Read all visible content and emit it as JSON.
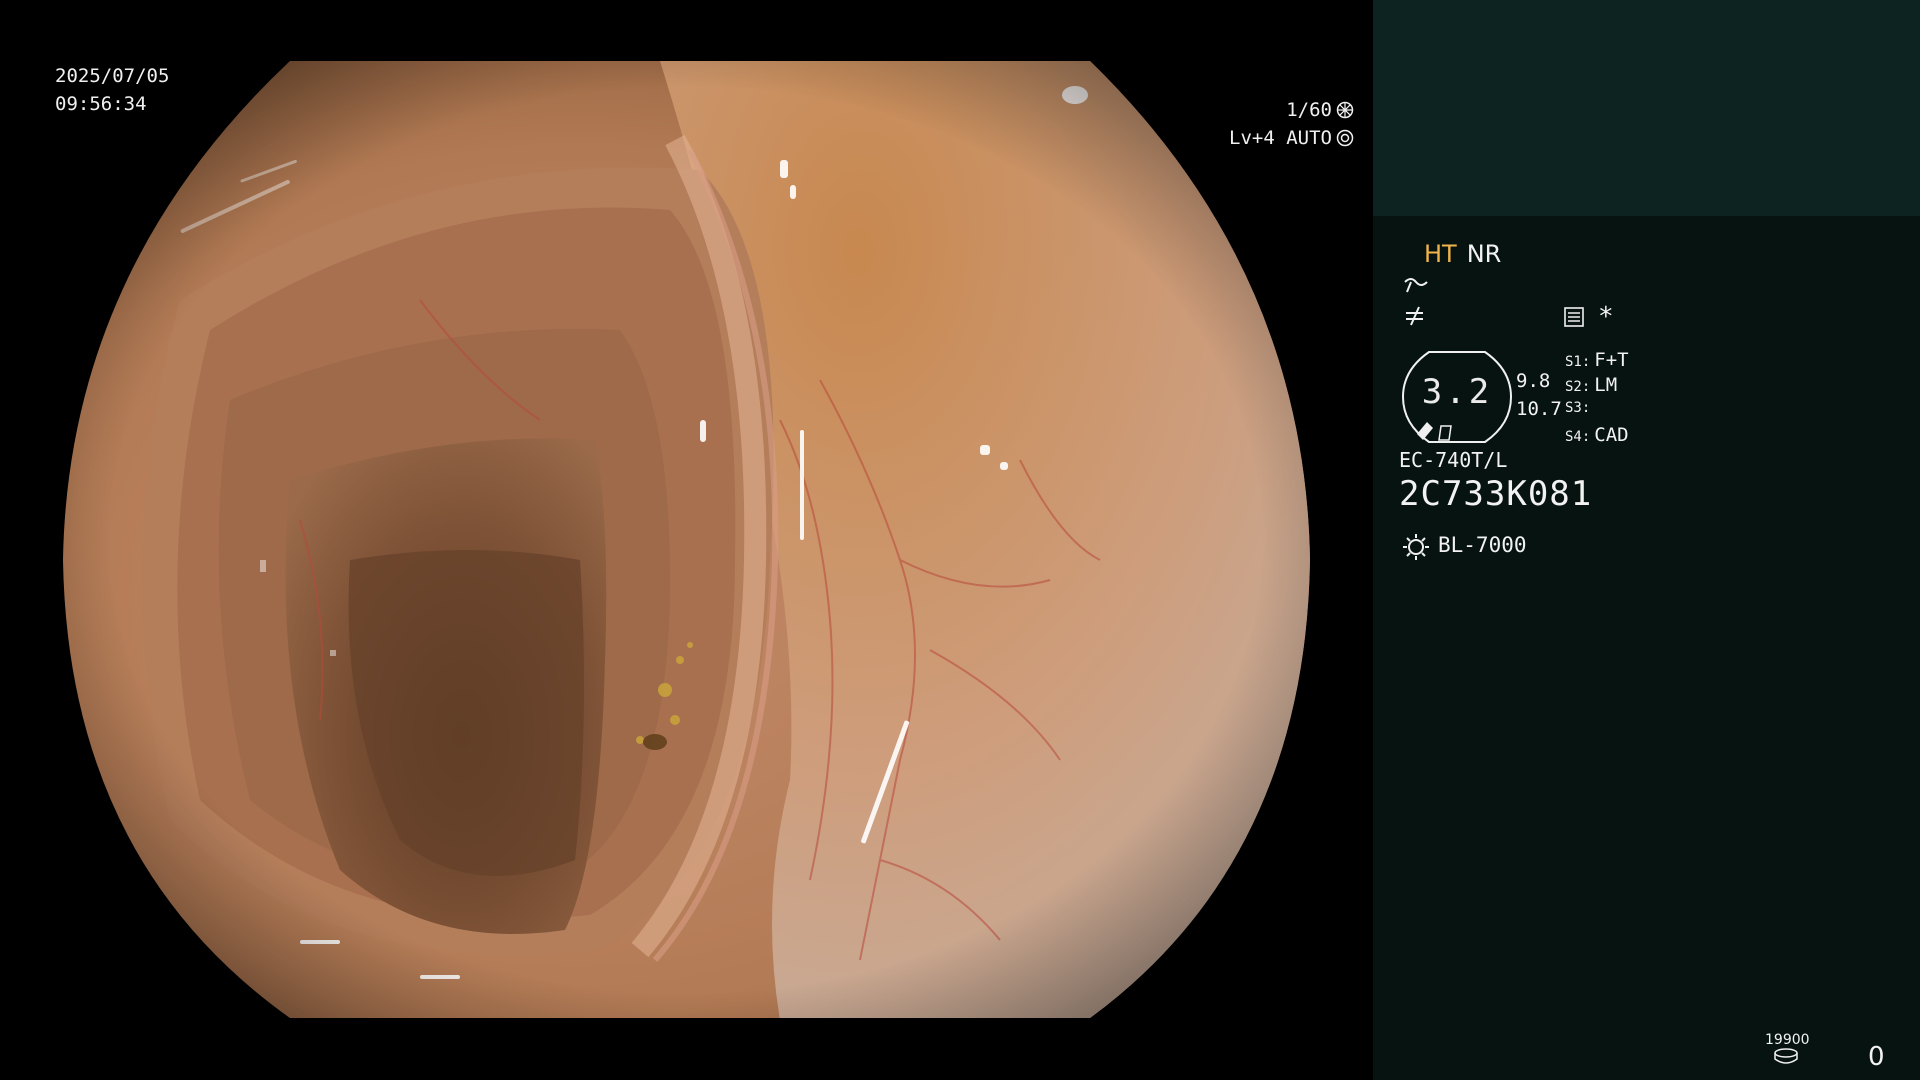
{
  "overlay": {
    "date": "2025/07/05",
    "time": "09:56:34",
    "shutter": "1/60",
    "iris": "Lv+4 AUTO"
  },
  "panel": {
    "enhancement_ht": "HT",
    "enhancement_nr": "NR",
    "magnification": "3.2",
    "mag_a": "9.8",
    "mag_b": "10.7",
    "switches": [
      {
        "key": "S1:",
        "value": "F+T"
      },
      {
        "key": "S2:",
        "value": "LM"
      },
      {
        "key": "S3:",
        "value": ""
      },
      {
        "key": "S4:",
        "value": "CAD"
      }
    ],
    "scope_model": "EC-740T/L",
    "scope_serial": "2C733K081",
    "light_source": "BL-7000",
    "storage_count_small": "19900",
    "storage_count": "0",
    "star": "*"
  },
  "colors": {
    "panel_bg": "#061310",
    "panel_top_bg": "#0d2321",
    "ht_accent": "#f0b44c"
  },
  "icons": [
    "shutter-icon",
    "iris-icon",
    "curve-icon",
    "slash-icon",
    "menu-icon",
    "magnification-badge",
    "light-bulb-icon",
    "disc-icon"
  ]
}
